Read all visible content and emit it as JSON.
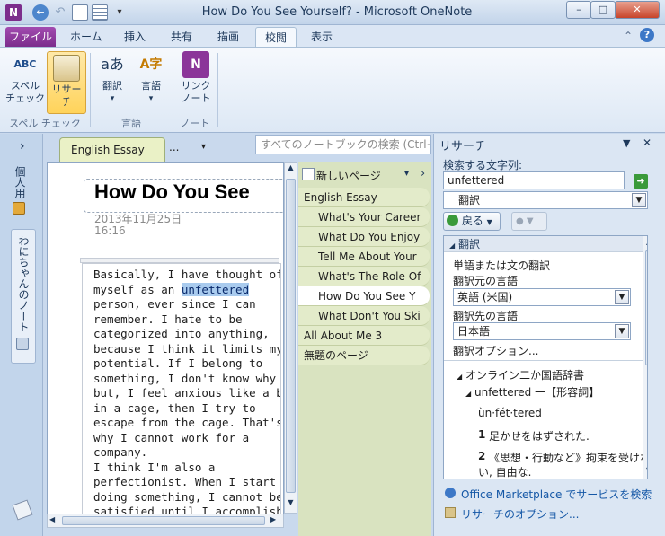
{
  "window": {
    "title": "How Do You See Yourself? - Microsoft OneNote",
    "app_icon": "N",
    "controls": {
      "minimize": "–",
      "maximize": "□",
      "close": "✕"
    }
  },
  "ribbon_tabs": [
    "ファイル",
    "ホーム",
    "挿入",
    "共有",
    "描画",
    "校閲",
    "表示"
  ],
  "ribbon": {
    "spelling": {
      "line1": "スペル",
      "line2": "チェック",
      "icon_text": "ABC"
    },
    "research": {
      "label": "リサーチ"
    },
    "translate": {
      "label": "翻訳",
      "icon_text": "aあ"
    },
    "language": {
      "label": "言語",
      "icon_text": "A字"
    },
    "linked_notes": {
      "line1": "リンク",
      "line2": "ノート",
      "icon_text": "N"
    },
    "groups": {
      "spelling": "スペル チェック",
      "language": "言語",
      "notes": "ノート"
    },
    "dropdown_arrow": "▾"
  },
  "notebook_bar": {
    "expand": "›",
    "notebooks": [
      "個人用",
      "わにちゃんのノート"
    ]
  },
  "sections": {
    "active": "English Essay",
    "more": "...",
    "more_arrow": "▾"
  },
  "search": {
    "placeholder": "すべてのノートブックの検索 (Ctrl+E)"
  },
  "page": {
    "title": "How Do You See",
    "date": "2013年11月25日",
    "time": "16:16",
    "body_lines": [
      "Basically, I have thought of",
      "myself as an ",
      "person, ever since I can",
      "remember.  I hate to be",
      "categorized into anything,",
      "because I think it limits my",
      "potential. If I belong to",
      "something, I don't know why",
      "but, I feel anxious like a bird",
      "in a cage, then I try to",
      "escape from the cage. That's",
      "why I cannot work for a",
      "company.",
      "I think I'm also a",
      "perfectionist. When I start",
      "doing something, I cannot be",
      "satisfied until I accomplish it."
    ],
    "highlighted_word": "unfettered"
  },
  "page_list": {
    "new_page": "新しいページ",
    "new_page_arrow": "▾",
    "nav_arrow": "›",
    "items": [
      {
        "label": "English Essay",
        "level": "top"
      },
      {
        "label": "What's Your Career",
        "level": "sub"
      },
      {
        "label": "What Do You Enjoy",
        "level": "sub"
      },
      {
        "label": "Tell Me About Your",
        "level": "sub"
      },
      {
        "label": "What's The Role Of",
        "level": "sub"
      },
      {
        "label": "How Do You See Y",
        "level": "sub",
        "selected": true
      },
      {
        "label": "What Don't You Ski",
        "level": "sub"
      },
      {
        "label": "All About Me 3",
        "level": "top"
      },
      {
        "label": "無題のページ",
        "level": "top"
      }
    ]
  },
  "research_pane": {
    "title": "リサーチ",
    "search_label": "検索する文字列:",
    "search_value": "unfettered",
    "service": "翻訳",
    "back_button": "戻る",
    "section_header": "翻訳",
    "translate_prompt": "単語または文の翻訳",
    "source_label": "翻訳元の言語",
    "source_value": "英語 (米国)",
    "target_label": "翻訳先の言語",
    "target_value": "日本語",
    "options_link": "翻訳オプション...",
    "dictionary": "オンライン二か国語辞書",
    "entry": "unfettered 一【形容詞】",
    "pronunciation": "ùn·fét·tered",
    "def1_num": "1",
    "def1": "足かせをはずされた.",
    "def2_num": "2",
    "def2_line1": "《思想・行動など》拘束を受けな",
    "def2_line2": "い, 自由な.",
    "marketplace_link": "Office Marketplace でサービスを検索",
    "research_options_link": "リサーチのオプション..."
  },
  "colors": {
    "file_tab": "#8b3599",
    "accent": "#1457a6",
    "highlight": "#a9cbee",
    "pagelist": "#e3ebca"
  }
}
